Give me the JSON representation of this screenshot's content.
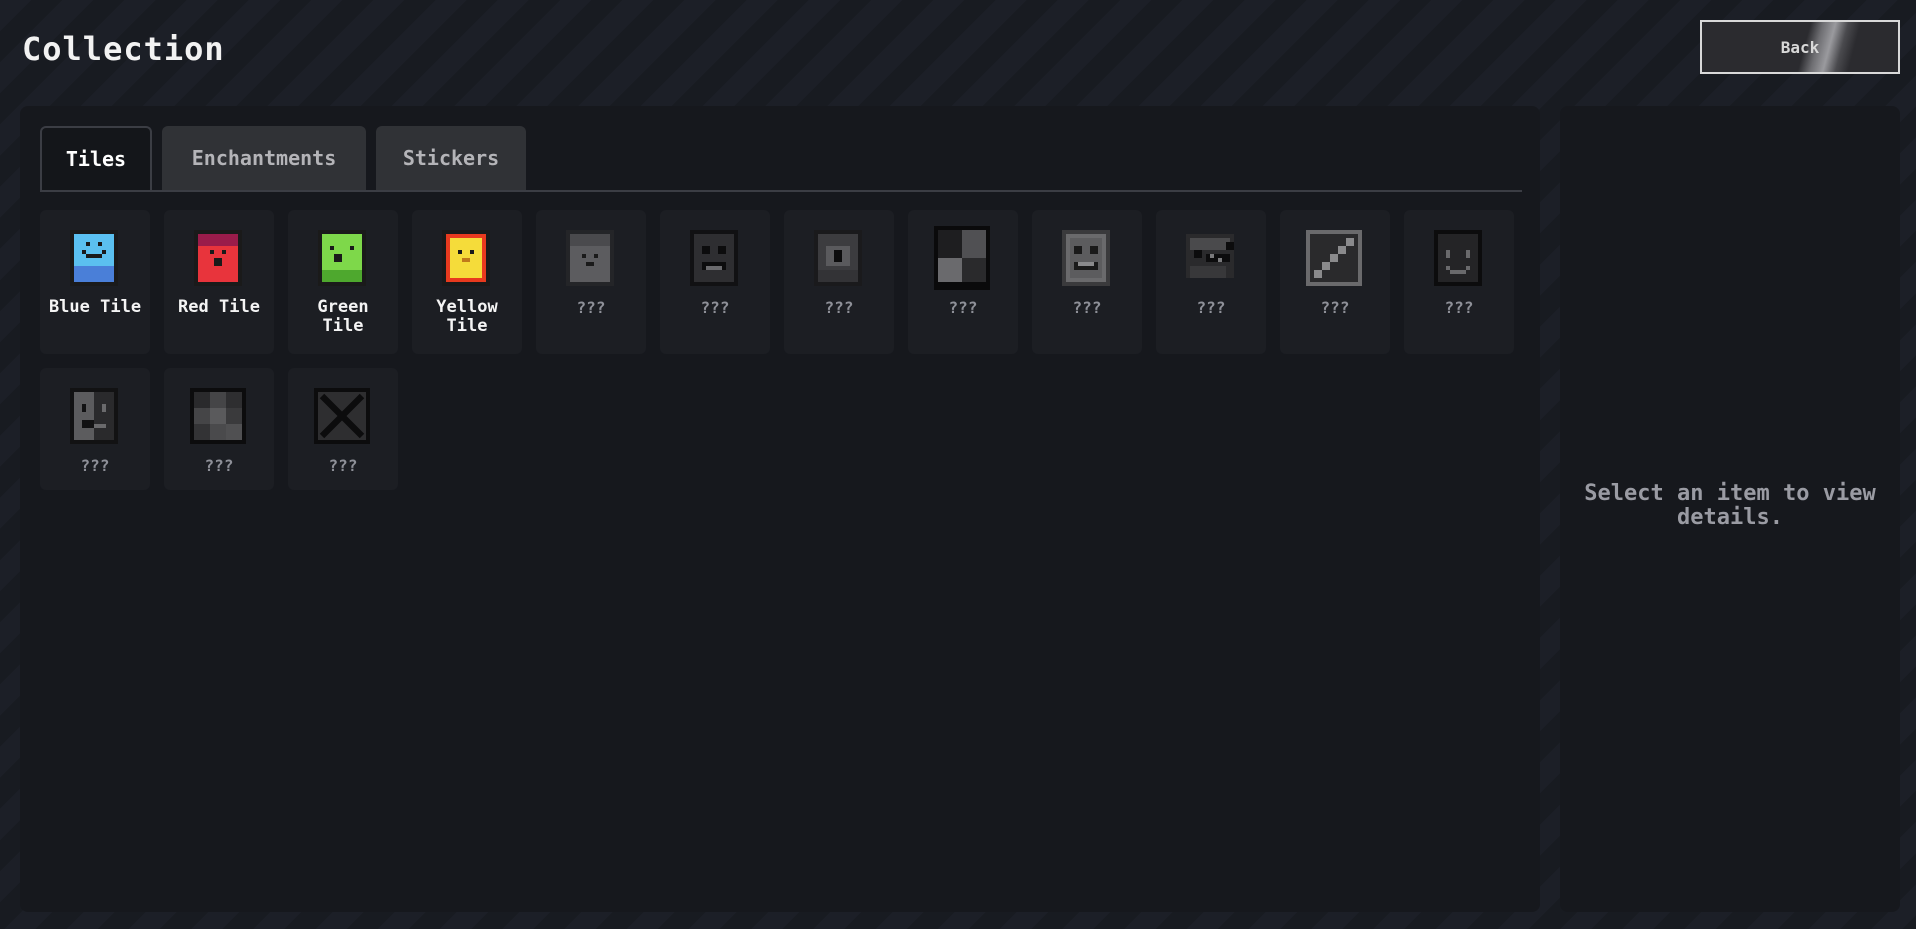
{
  "header": {
    "title": "Collection",
    "back_label": "Back"
  },
  "tabs": [
    {
      "label": "Tiles"
    },
    {
      "label": "Enchantments"
    },
    {
      "label": "Stickers"
    }
  ],
  "active_tab": "Tiles",
  "items": [
    {
      "label": "Blue Tile",
      "icon": "blue-tile-icon",
      "locked": false,
      "color": "#5bc0ef"
    },
    {
      "label": "Red Tile",
      "icon": "red-tile-icon",
      "locked": false,
      "color": "#e8343c"
    },
    {
      "label": "Green\nTile",
      "icon": "green-tile-icon",
      "locked": false,
      "color": "#7ed84a"
    },
    {
      "label": "Yellow\nTile",
      "icon": "yellow-tile-icon",
      "locked": false,
      "color": "#f5dc3a"
    },
    {
      "label": "???",
      "icon": "locked-gray-face-icon",
      "locked": true
    },
    {
      "label": "???",
      "icon": "locked-dark-face-icon",
      "locked": true
    },
    {
      "label": "???",
      "icon": "locked-eye-icon",
      "locked": true
    },
    {
      "label": "???",
      "icon": "locked-checker-icon",
      "locked": true
    },
    {
      "label": "???",
      "icon": "locked-grin-icon",
      "locked": true
    },
    {
      "label": "???",
      "icon": "locked-jaw-icon",
      "locked": true
    },
    {
      "label": "???",
      "icon": "locked-slash-icon",
      "locked": true
    },
    {
      "label": "???",
      "icon": "locked-smile-icon",
      "locked": true
    },
    {
      "label": "???",
      "icon": "locked-half-face-icon",
      "locked": true
    },
    {
      "label": "???",
      "icon": "locked-blur-icon",
      "locked": true
    },
    {
      "label": "???",
      "icon": "locked-cross-icon",
      "locked": true
    }
  ],
  "detail": {
    "placeholder": "Select an item to view details."
  }
}
